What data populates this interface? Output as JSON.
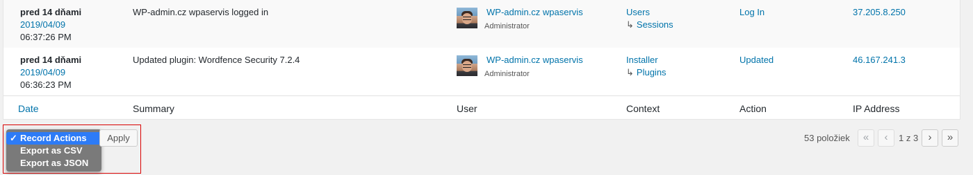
{
  "rows": [
    {
      "when": "pred 14 dňami",
      "date": "2019/04/09",
      "time": "06:37:26 PM",
      "summary": "WP-admin.cz wpaservis logged in",
      "user_name": "WP-admin.cz wpaservis",
      "user_role": "Administrator",
      "context": "Users",
      "context_sub": "Sessions",
      "action": "Log In",
      "ip": "37.205.8.250"
    },
    {
      "when": "pred 14 dňami",
      "date": "2019/04/09",
      "time": "06:36:23 PM",
      "summary": "Updated plugin: Wordfence Security 7.2.4",
      "user_name": "WP-admin.cz wpaservis",
      "user_role": "Administrator",
      "context": "Installer",
      "context_sub": "Plugins",
      "action": "Updated",
      "ip": "46.167.241.3"
    }
  ],
  "columns": {
    "date": "Date",
    "summary": "Summary",
    "user": "User",
    "context": "Context",
    "action": "Action",
    "ip": "IP Address"
  },
  "sub_arrow": "↳",
  "bulk": {
    "options": [
      "Record Actions",
      "Export as CSV",
      "Export as JSON"
    ],
    "selected": "Record Actions",
    "check": "✓",
    "apply_label": "Apply"
  },
  "pagination": {
    "count": "53 položiek",
    "first": "«",
    "prev": "‹",
    "page_text": "1 z 3",
    "next": "›",
    "last": "»"
  },
  "colors": {
    "link": "#0073aa",
    "selected_option": "#2d7bf6",
    "highlight_border": "#d80000"
  }
}
